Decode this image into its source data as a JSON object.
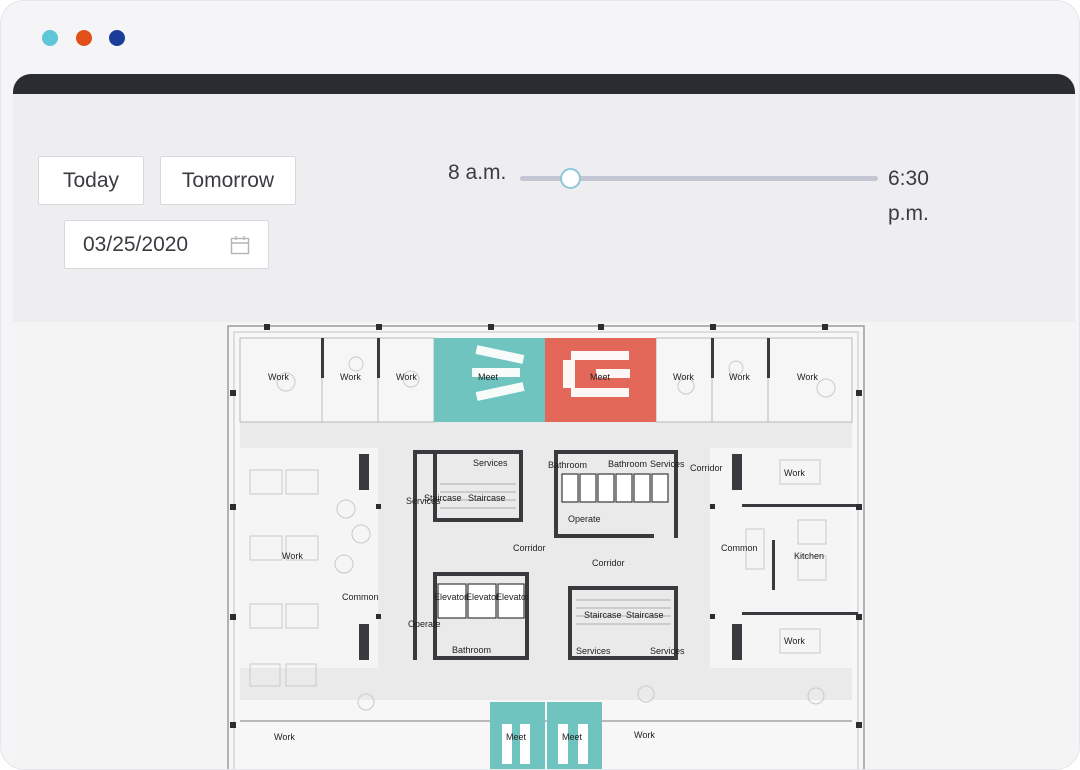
{
  "window": {
    "dots": [
      {
        "name": "window-dot-teal",
        "color": "#5ec6d6"
      },
      {
        "name": "window-dot-orange",
        "color": "#e2501a"
      },
      {
        "name": "window-dot-blue",
        "color": "#1a3d9a"
      }
    ]
  },
  "controls": {
    "today_label": "Today",
    "tomorrow_label": "Tomorrow",
    "date_value": "03/25/2020",
    "time_start": "8 a.m.",
    "time_end": "6:30 p.m.",
    "slider_position": 0.14
  },
  "floor_plan": {
    "colors": {
      "available": "#6fc4c0",
      "booked": "#e3685a",
      "wall": "#3a3a3e",
      "floor": "#eaeaeb"
    },
    "labels": {
      "work": "Work",
      "meet": "Meet",
      "services": "Services",
      "bathroom": "Bathroom",
      "corridor": "Corridor",
      "staircase": "Staircase",
      "operate": "Operate",
      "common": "Common",
      "kitchen": "Kitchen",
      "elevator": "Elevator"
    }
  }
}
